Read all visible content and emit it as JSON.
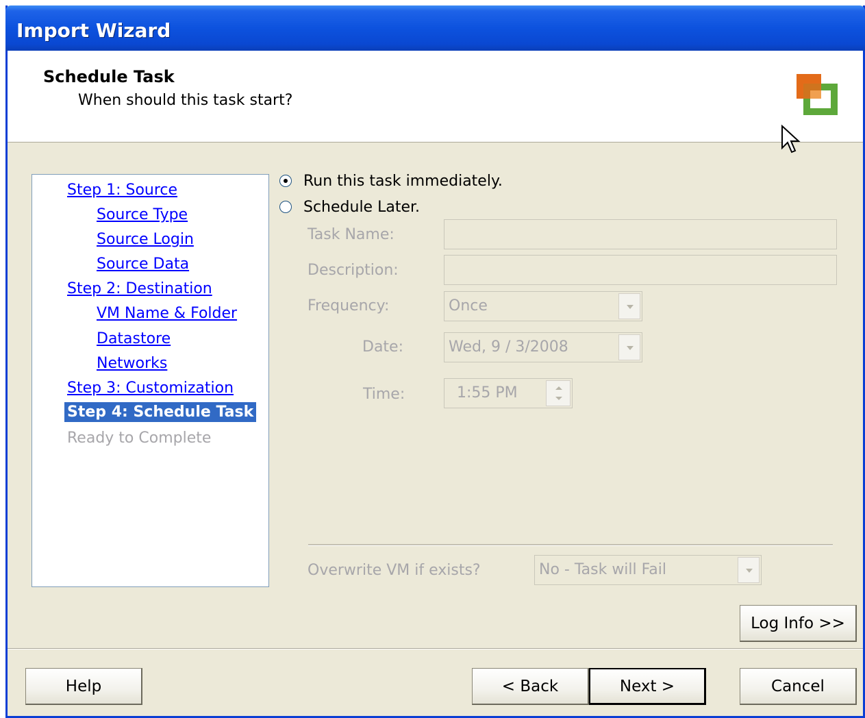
{
  "window": {
    "title": "Import Wizard"
  },
  "header": {
    "title": "Schedule Task",
    "subtitle": "When should this task start?",
    "logo_icon": "vmware-converter-logo-icon"
  },
  "steps": [
    {
      "label": "Step 1: Source",
      "state": "link"
    },
    {
      "label": "Source Type",
      "state": "link"
    },
    {
      "label": "Source Login",
      "state": "link"
    },
    {
      "label": "Source Data",
      "state": "link"
    },
    {
      "label": "Step 2: Destination",
      "state": "link"
    },
    {
      "label": "VM Name & Folder",
      "state": "link"
    },
    {
      "label": "Datastore",
      "state": "link"
    },
    {
      "label": "Networks",
      "state": "link"
    },
    {
      "label": "Step 3: Customization",
      "state": "link"
    },
    {
      "label": "Step 4: Schedule Task",
      "state": "current"
    },
    {
      "label": "Ready to Complete",
      "state": "disabled"
    }
  ],
  "schedule": {
    "run_now_label": "Run this task immediately.",
    "run_now_selected": true,
    "later_label": "Schedule Later.",
    "later_selected": false,
    "task_name_label": "Task Name:",
    "task_name_value": "",
    "description_label": "Description:",
    "description_value": "",
    "frequency_label": "Frequency:",
    "frequency_value": "Once",
    "date_label": "Date:",
    "date_value": "Wed,  9 / 3/2008",
    "time_label": "Time:",
    "time_value": "1:55 PM"
  },
  "overwrite": {
    "label": "Overwrite VM if exists?",
    "value": "No - Task will Fail"
  },
  "buttons": {
    "log_info": "Log Info >>",
    "help": "Help",
    "back": "< Back",
    "next": "Next >",
    "cancel": "Cancel"
  },
  "colors": {
    "title_bar": "#0a48d2",
    "selected_step": "#316ac5",
    "link": "#0000ff",
    "disabled_text": "#a7a6aa",
    "dialog_bg": "#ece9d8"
  }
}
